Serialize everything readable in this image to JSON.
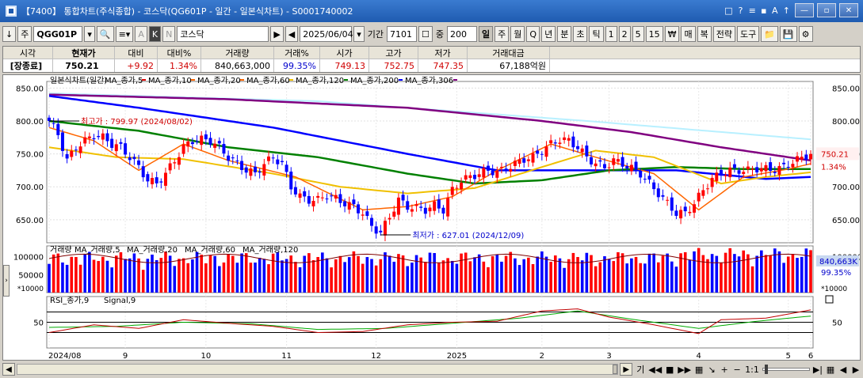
{
  "window": {
    "code_tag": "【7400】",
    "title": "통합차트(주식종합) - 코스닥(QG601P - 일간 - 일본식차트) - S0001740002",
    "right_icons": [
      "□",
      "?",
      "≡",
      "▪",
      "A",
      "↑"
    ],
    "controls": [
      "—",
      "▫",
      "✕"
    ]
  },
  "toolbar": {
    "down_icon": "↓",
    "jong_label": "주",
    "code_value": "QGG01P",
    "name_value": "코스닥",
    "date_value": "2025/06/04",
    "period_label": "기간",
    "period_value": "7101",
    "count_label": "중",
    "count_value": "200",
    "interval_buttons": [
      "일",
      "주",
      "월",
      "Q",
      "년",
      "분",
      "초",
      "틱"
    ],
    "number_buttons": [
      "1",
      "2",
      "5",
      "15"
    ],
    "right_buttons": [
      "매",
      "복",
      "전략",
      "도구"
    ],
    "won_label": "₩"
  },
  "quote": {
    "headers": [
      "시각",
      "현재가",
      "대비",
      "대비%",
      "거래량",
      "거래%",
      "시가",
      "고가",
      "저가",
      "거래대금"
    ],
    "values": [
      "[장종료]",
      "750.21",
      "+9.92",
      "1.34%",
      "840,663,000",
      "99.35%",
      "749.13",
      "752.75",
      "747.35",
      "67,188억원"
    ]
  },
  "chart": {
    "main_legend": [
      "일본식차트(일간)",
      "MA_종가,5",
      "MA_종가,10",
      "MA_종가,20",
      "MA_종가,60",
      "MA_종가,120",
      "MA_종가,200",
      "MA_종가,306"
    ],
    "legend_colors": [
      "#000000",
      "#e00000",
      "#ff6600",
      "#ff6600",
      "#f0c000",
      "#008000",
      "#0000ff",
      "#800080"
    ],
    "max_label": "최고가 : 799.97 (2024/08/02)",
    "min_label": "최저가 : 627.01 (2024/12/09)",
    "price_ticks": [
      "850.00",
      "800.00",
      "750.00",
      "700.00",
      "650.00"
    ],
    "current_price": "750.21",
    "current_pct": "1.34%",
    "volume_legend": [
      "거래량",
      "MA_거래량,5",
      "MA_거래량,20",
      "MA_거래량,60",
      "MA_거래량,120"
    ],
    "volume_ticks": [
      "100000",
      "50000"
    ],
    "volume_unit": "*10000",
    "volume_current": "840,663K",
    "volume_pct": "99.35%",
    "rsi_legend": [
      "RSI_종가,9",
      "Signal,9"
    ],
    "rsi_tick": "50",
    "x_labels": [
      "2024/08",
      "9",
      "10",
      "11",
      "12",
      "2025",
      "2",
      "3",
      "4",
      "5",
      "6"
    ]
  },
  "chart_data": {
    "type": "candlestick",
    "series_ma_colors": {
      "ma5": "#e00000",
      "ma10": "#ff6600",
      "ma20": "#ff6600",
      "ma60": "#f0c000",
      "ma120": "#008000",
      "ma200": "#0000ff",
      "ma306": "#800080"
    },
    "ylim": [
      615,
      860
    ],
    "close_anchor": {
      "max": 799.97,
      "min": 627.01,
      "last": 750.21
    },
    "price_path": [
      [
        0,
        800
      ],
      [
        2,
        780
      ],
      [
        4,
        740
      ],
      [
        6,
        760
      ],
      [
        8,
        770
      ],
      [
        10,
        778
      ],
      [
        12,
        775
      ],
      [
        14,
        765
      ],
      [
        16,
        760
      ],
      [
        18,
        745
      ],
      [
        20,
        730
      ],
      [
        22,
        710
      ],
      [
        24,
        705
      ],
      [
        26,
        720
      ],
      [
        28,
        740
      ],
      [
        30,
        760
      ],
      [
        32,
        770
      ],
      [
        34,
        772
      ],
      [
        36,
        770
      ],
      [
        38,
        760
      ],
      [
        40,
        745
      ],
      [
        42,
        735
      ],
      [
        44,
        725
      ],
      [
        46,
        720
      ],
      [
        48,
        735
      ],
      [
        50,
        745
      ],
      [
        52,
        735
      ],
      [
        54,
        700
      ],
      [
        56,
        685
      ],
      [
        58,
        680
      ],
      [
        60,
        680
      ],
      [
        62,
        688
      ],
      [
        64,
        682
      ],
      [
        66,
        675
      ],
      [
        68,
        670
      ],
      [
        70,
        660
      ],
      [
        72,
        640
      ],
      [
        74,
        630
      ],
      [
        76,
        655
      ],
      [
        78,
        680
      ],
      [
        80,
        670
      ],
      [
        82,
        668
      ],
      [
        84,
        665
      ],
      [
        86,
        672
      ],
      [
        88,
        665
      ],
      [
        90,
        695
      ],
      [
        92,
        710
      ],
      [
        94,
        715
      ],
      [
        96,
        720
      ],
      [
        98,
        725
      ],
      [
        100,
        722
      ],
      [
        102,
        728
      ],
      [
        104,
        735
      ],
      [
        106,
        742
      ],
      [
        108,
        745
      ],
      [
        110,
        755
      ],
      [
        112,
        765
      ],
      [
        114,
        772
      ],
      [
        116,
        770
      ],
      [
        118,
        760
      ],
      [
        120,
        745
      ],
      [
        122,
        735
      ],
      [
        124,
        730
      ],
      [
        126,
        740
      ],
      [
        128,
        735
      ],
      [
        130,
        728
      ],
      [
        132,
        720
      ],
      [
        134,
        705
      ],
      [
        136,
        690
      ],
      [
        138,
        675
      ],
      [
        140,
        660
      ],
      [
        142,
        660
      ],
      [
        144,
        675
      ],
      [
        146,
        695
      ],
      [
        148,
        712
      ],
      [
        150,
        720
      ],
      [
        152,
        725
      ],
      [
        154,
        725
      ],
      [
        156,
        725
      ],
      [
        158,
        728
      ],
      [
        160,
        727
      ],
      [
        162,
        726
      ],
      [
        164,
        730
      ],
      [
        166,
        738
      ],
      [
        168,
        744
      ],
      [
        170,
        750
      ]
    ],
    "ma306_path": [
      [
        0,
        840
      ],
      [
        40,
        833
      ],
      [
        80,
        820
      ],
      [
        110,
        800
      ],
      [
        130,
        783
      ],
      [
        150,
        760
      ],
      [
        170,
        740
      ]
    ],
    "ma200_path": [
      [
        0,
        838
      ],
      [
        20,
        820
      ],
      [
        50,
        790
      ],
      [
        80,
        750
      ],
      [
        100,
        725
      ],
      [
        120,
        725
      ],
      [
        140,
        725
      ],
      [
        160,
        712
      ],
      [
        170,
        715
      ]
    ],
    "ma120_path": [
      [
        0,
        800
      ],
      [
        20,
        785
      ],
      [
        40,
        760
      ],
      [
        60,
        745
      ],
      [
        80,
        720
      ],
      [
        95,
        705
      ],
      [
        110,
        710
      ],
      [
        125,
        725
      ],
      [
        140,
        730
      ],
      [
        155,
        727
      ],
      [
        170,
        727
      ]
    ],
    "ma60_path": [
      [
        0,
        760
      ],
      [
        15,
        745
      ],
      [
        30,
        742
      ],
      [
        50,
        720
      ],
      [
        65,
        700
      ],
      [
        80,
        690
      ],
      [
        95,
        698
      ],
      [
        110,
        730
      ],
      [
        122,
        755
      ],
      [
        135,
        745
      ],
      [
        150,
        705
      ],
      [
        160,
        715
      ],
      [
        170,
        722
      ]
    ],
    "ma_fast_path": [
      [
        0,
        790
      ],
      [
        10,
        770
      ],
      [
        20,
        725
      ],
      [
        30,
        765
      ],
      [
        40,
        740
      ],
      [
        55,
        715
      ],
      [
        70,
        665
      ],
      [
        80,
        670
      ],
      [
        90,
        685
      ],
      [
        100,
        725
      ],
      [
        112,
        765
      ],
      [
        122,
        745
      ],
      [
        135,
        720
      ],
      [
        145,
        665
      ],
      [
        155,
        715
      ],
      [
        165,
        727
      ],
      [
        170,
        735
      ]
    ],
    "volume_bars_seed": 171,
    "rsi_path": [
      [
        0,
        30
      ],
      [
        10,
        45
      ],
      [
        20,
        38
      ],
      [
        30,
        55
      ],
      [
        40,
        48
      ],
      [
        50,
        42
      ],
      [
        60,
        30
      ],
      [
        70,
        32
      ],
      [
        80,
        45
      ],
      [
        90,
        50
      ],
      [
        100,
        52
      ],
      [
        110,
        72
      ],
      [
        118,
        76
      ],
      [
        125,
        60
      ],
      [
        135,
        45
      ],
      [
        145,
        28
      ],
      [
        150,
        55
      ],
      [
        160,
        58
      ],
      [
        170,
        74
      ]
    ],
    "signal_path": [
      [
        0,
        40
      ],
      [
        15,
        42
      ],
      [
        30,
        50
      ],
      [
        45,
        47
      ],
      [
        60,
        36
      ],
      [
        75,
        38
      ],
      [
        90,
        48
      ],
      [
        105,
        58
      ],
      [
        118,
        72
      ],
      [
        130,
        56
      ],
      [
        145,
        38
      ],
      [
        158,
        52
      ],
      [
        170,
        62
      ]
    ]
  }
}
